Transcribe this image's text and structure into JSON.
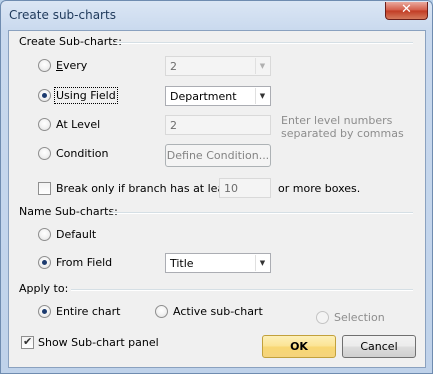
{
  "window": {
    "title": "Create sub-charts",
    "close_glyph": "✕"
  },
  "create_section": {
    "label": "Create Sub-charts:",
    "every": {
      "label": "Every",
      "value": "2"
    },
    "using_field": {
      "label": "Using Field",
      "value": "Department"
    },
    "at_level": {
      "label": "At Level",
      "value": "2",
      "hint_line1": "Enter level numbers",
      "hint_line2": "separated by commas"
    },
    "condition": {
      "label": "Condition",
      "button_label": "Define Condition..."
    },
    "break_only": {
      "label": "Break only if branch has at least",
      "value": "10",
      "suffix": "or more boxes."
    }
  },
  "name_section": {
    "label": "Name Sub-charts:",
    "default": {
      "label": "Default"
    },
    "from_field": {
      "label": "From Field",
      "value": "Title"
    }
  },
  "apply_section": {
    "label": "Apply to:",
    "entire_chart": {
      "label": "Entire chart"
    },
    "active_subchart": {
      "label": "Active sub-chart"
    },
    "selection": {
      "label": "Selection"
    }
  },
  "footer": {
    "show_panel": {
      "label": "Show Sub-chart panel",
      "checked": true
    },
    "ok_label": "OK",
    "cancel_label": "Cancel"
  },
  "icons": {
    "dropdown": "chevron-down-icon",
    "check": "check-icon",
    "close": "close-icon"
  }
}
